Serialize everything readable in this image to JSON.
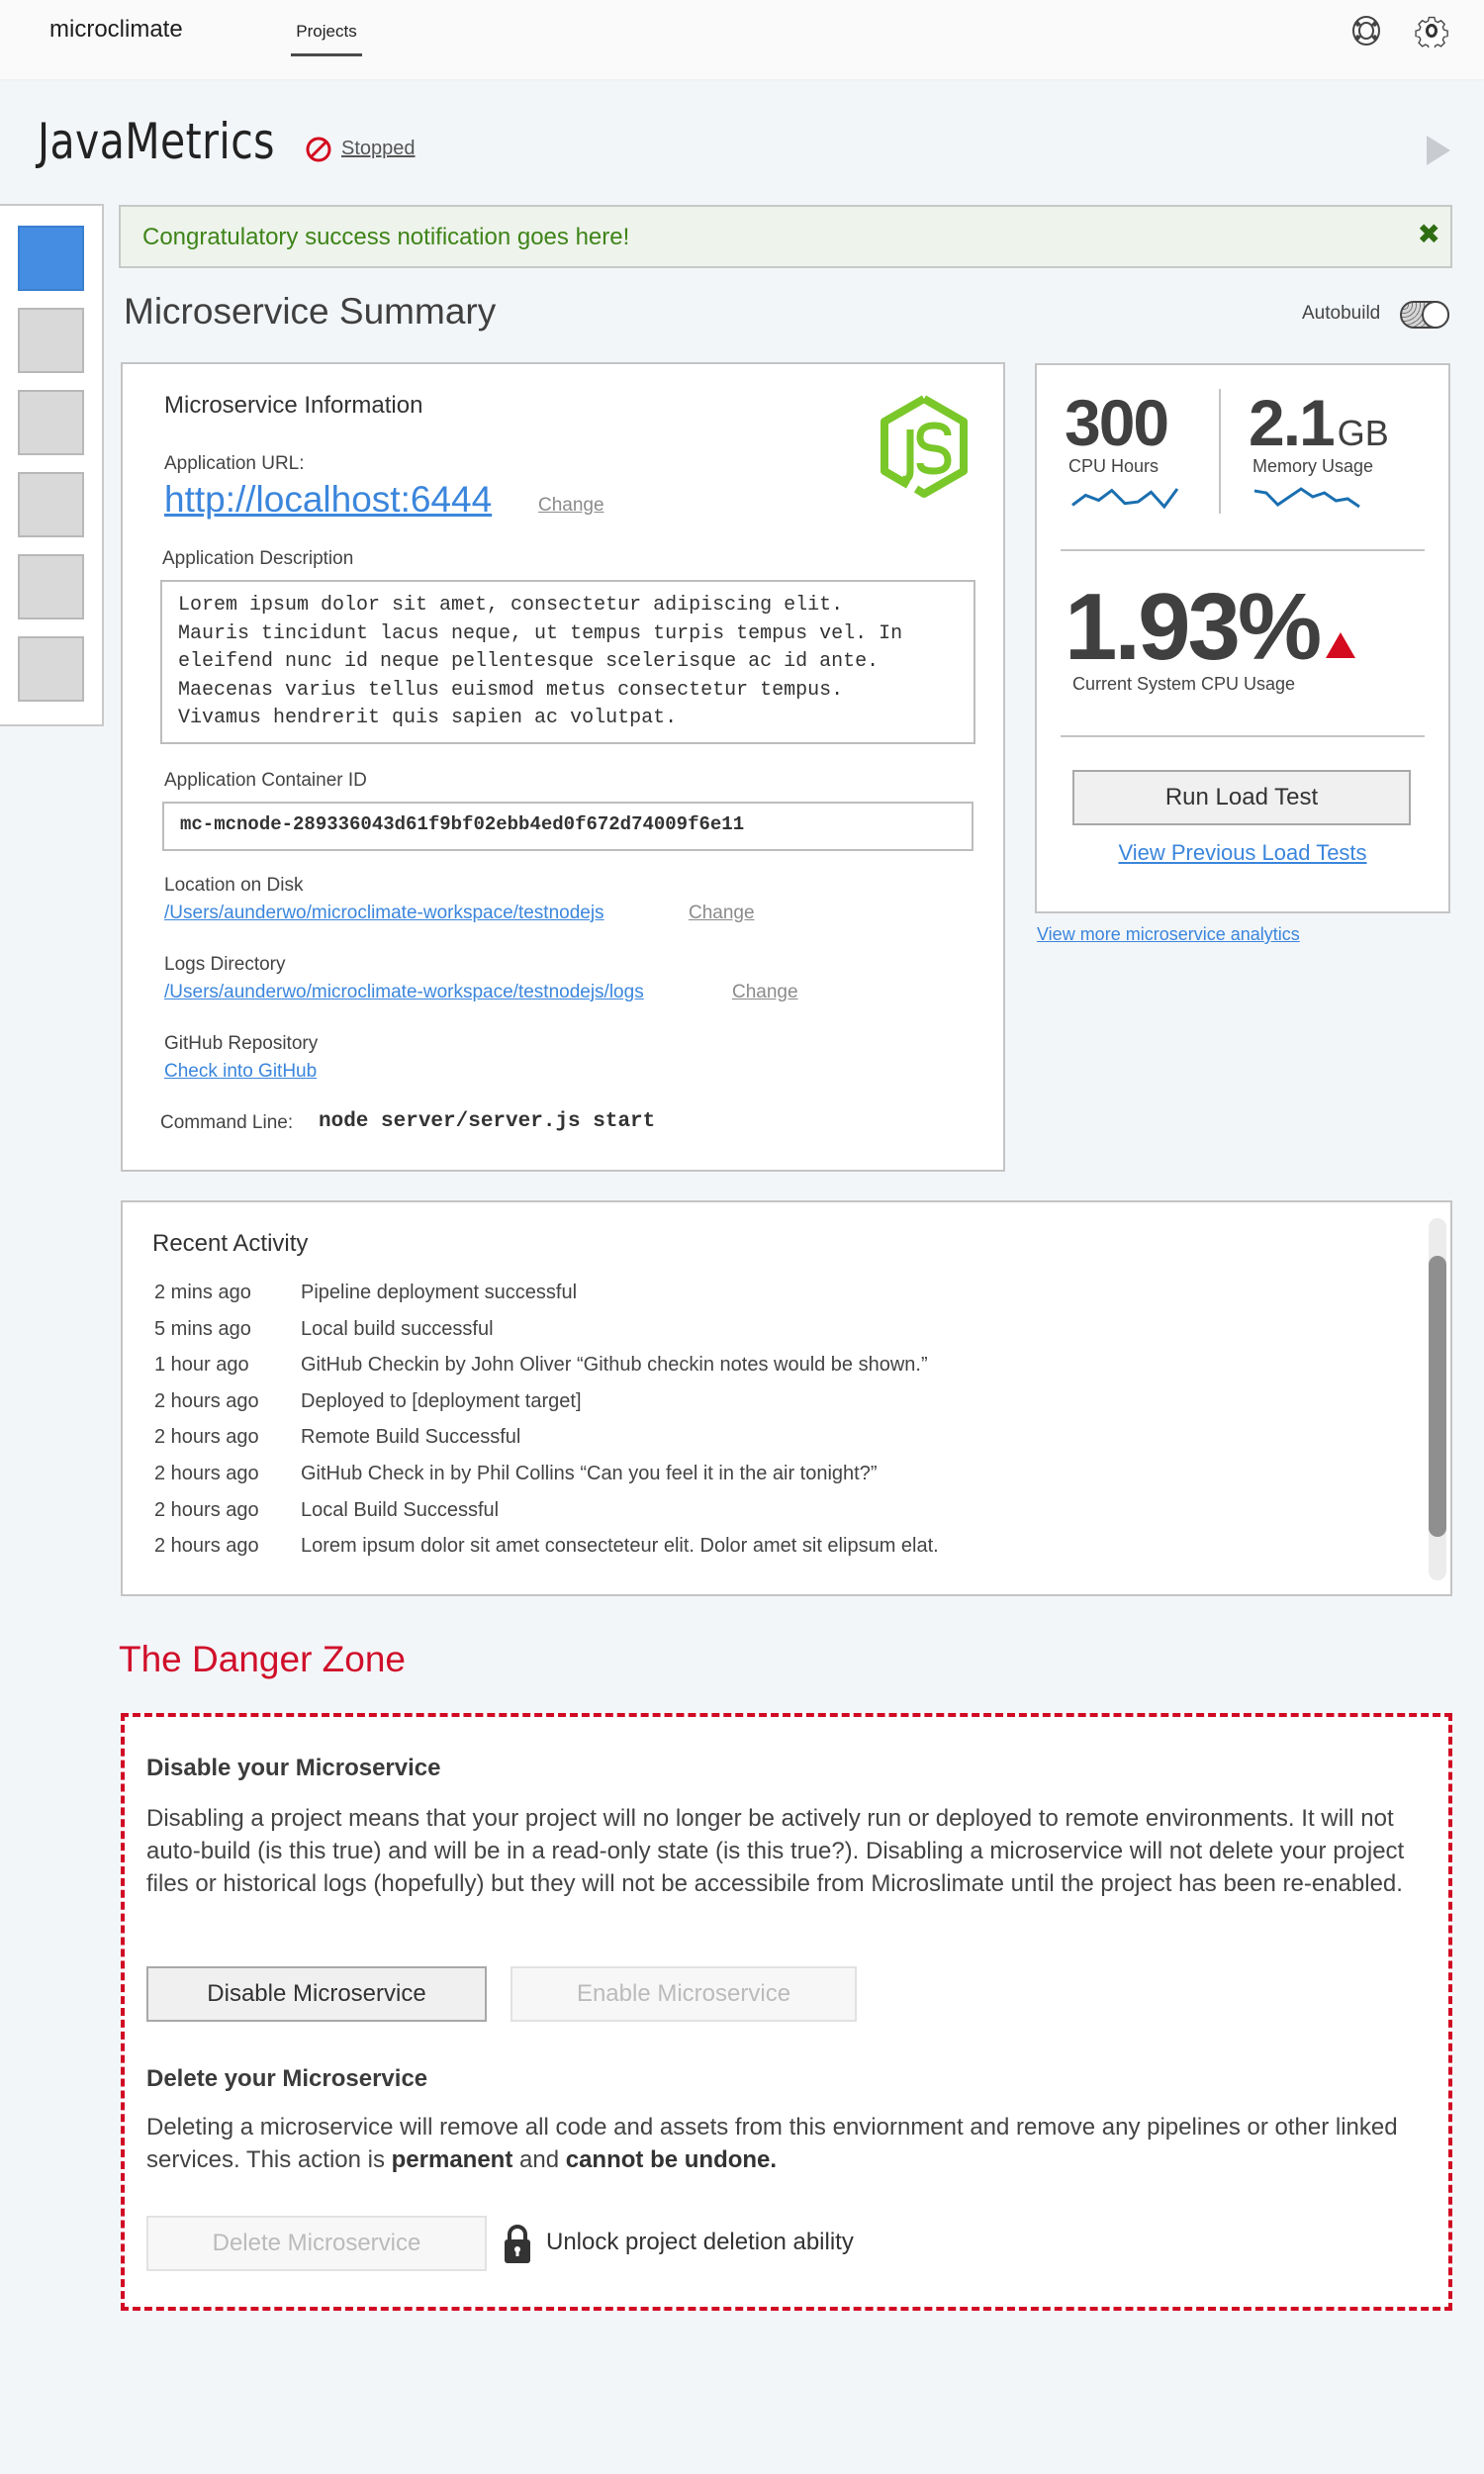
{
  "topbar": {
    "brand": "microclimate",
    "tabs": [
      {
        "label": "Projects",
        "active": true
      }
    ],
    "icons": [
      "help-icon",
      "gear-icon"
    ]
  },
  "project": {
    "title": "JavaMetrics",
    "status": "Stopped",
    "status_icon": "stopped-icon",
    "run_icon": "play-icon"
  },
  "sidebar": {
    "items": [
      {
        "name": "sidebar-item-1",
        "active": true
      },
      {
        "name": "sidebar-item-2",
        "active": false
      },
      {
        "name": "sidebar-item-3",
        "active": false
      },
      {
        "name": "sidebar-item-4",
        "active": false
      },
      {
        "name": "sidebar-item-5",
        "active": false
      },
      {
        "name": "sidebar-item-6",
        "active": false
      }
    ]
  },
  "notification": {
    "text": "Congratulatory success notification goes here!",
    "close_label": "✖"
  },
  "summary": {
    "title": "Microservice Summary",
    "autobuild_label": "Autobuild",
    "autobuild_on": false
  },
  "info": {
    "title": "Microservice Information",
    "logo": "nodejs-logo",
    "app_url_label": "Application URL:",
    "app_url": "http://localhost:6444",
    "change_label": "Change",
    "description_label": "Application Description",
    "description": "Lorem ipsum dolor sit amet, consectetur adipiscing elit.\nMauris tincidunt lacus neque, ut tempus turpis tempus vel. In\neleifend nunc id neque pellentesque scelerisque ac id ante.\nMaecenas varius tellus euismod metus consectetur tempus.\nVivamus hendrerit quis sapien ac volutpat.",
    "container_label": "Application Container ID",
    "container_id": "mc-mcnode-289336043d61f9bf02ebb4ed0f672d74009f6e11",
    "location_label": "Location on Disk",
    "location_path": "/Users/aunderwo/microclimate-workspace/testnodejs",
    "logs_label": "Logs Directory",
    "logs_path": "/Users/aunderwo/microclimate-workspace/testnodejs/logs",
    "github_label": "GitHub Repository",
    "github_link": "Check into GitHub",
    "command_label": "Command Line:",
    "command_value": "node server/server.js start"
  },
  "metrics": {
    "cpu_hours": "300",
    "cpu_hours_label": "CPU Hours",
    "memory_value": "2.1",
    "memory_unit": "GB",
    "memory_label": "Memory Usage",
    "cpu_usage": "1.93%",
    "cpu_usage_label": "Current System CPU Usage",
    "cpu_trend": "up",
    "trend_color": "#d40a1e",
    "sparkline_color": "#1a6fb0",
    "cpu_sparkline": [
      2,
      8,
      5,
      11,
      3,
      4,
      10,
      1,
      12
    ],
    "memory_sparkline": [
      9,
      8,
      2,
      6,
      10,
      6,
      8,
      4,
      5,
      1
    ],
    "run_load_test": "Run Load Test",
    "view_previous": "View Previous Load Tests",
    "view_more": "View more microservice analytics"
  },
  "activity": {
    "title": "Recent Activity",
    "items": [
      {
        "time": "2 mins ago",
        "text": "Pipeline deployment successful"
      },
      {
        "time": "5 mins ago",
        "text": "Local build successful"
      },
      {
        "time": "1 hour ago",
        "text": "GitHub Checkin by John Oliver “Github checkin notes would be shown.”"
      },
      {
        "time": "2 hours ago",
        "text": "Deployed to [deployment target]"
      },
      {
        "time": "2 hours ago",
        "text": "Remote Build Successful"
      },
      {
        "time": "2 hours ago",
        "text": "GitHub Check in by Phil Collins “Can you feel it in the air tonight?”"
      },
      {
        "time": "2 hours ago",
        "text": "Local Build Successful"
      },
      {
        "time": "2 hours ago",
        "text": "Lorem ipsum dolor sit amet consecteteur elit. Dolor amet sit elipsum elat."
      }
    ]
  },
  "danger": {
    "title": "The Danger Zone",
    "color": "#d10a24",
    "disable_title": "Disable your Microservice",
    "disable_text": "Disabling a project means that your project will no longer be actively run or deployed to remote environments. It will not auto-build (is this true) and will be in a read-only state (is this true?). Disabling a microservice will not delete your project files or historical logs (hopefully) but they will not be accessibile from Microslimate until the project has been re-enabled.",
    "disable_button": "Disable Microservice",
    "enable_button": "Enable Microservice",
    "delete_title": "Delete your Microservice",
    "delete_text_1": "Deleting a microservice will remove all code and assets from this enviornment and remove any pipelines or other linked services. This action is ",
    "delete_text_bold_1": "permanent",
    "delete_text_2": " and ",
    "delete_text_bold_2": "cannot be undone.",
    "delete_button": "Delete Microservice",
    "unlock_label": "Unlock project deletion ability"
  }
}
